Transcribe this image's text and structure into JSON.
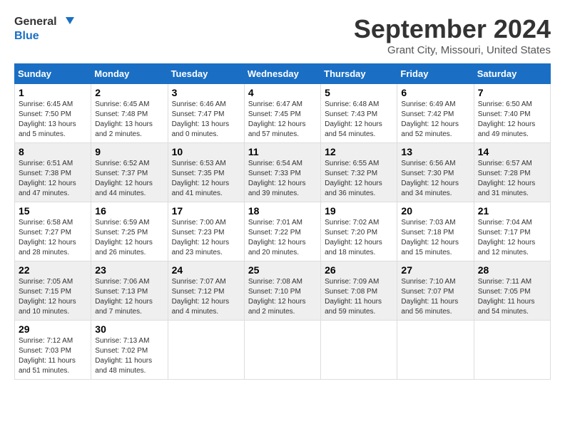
{
  "logo": {
    "line1": "General",
    "line2": "Blue"
  },
  "title": "September 2024",
  "subtitle": "Grant City, Missouri, United States",
  "headers": [
    "Sunday",
    "Monday",
    "Tuesday",
    "Wednesday",
    "Thursday",
    "Friday",
    "Saturday"
  ],
  "weeks": [
    [
      {
        "day": "1",
        "info": "Sunrise: 6:45 AM\nSunset: 7:50 PM\nDaylight: 13 hours and 5 minutes."
      },
      {
        "day": "2",
        "info": "Sunrise: 6:45 AM\nSunset: 7:48 PM\nDaylight: 13 hours and 2 minutes."
      },
      {
        "day": "3",
        "info": "Sunrise: 6:46 AM\nSunset: 7:47 PM\nDaylight: 13 hours and 0 minutes."
      },
      {
        "day": "4",
        "info": "Sunrise: 6:47 AM\nSunset: 7:45 PM\nDaylight: 12 hours and 57 minutes."
      },
      {
        "day": "5",
        "info": "Sunrise: 6:48 AM\nSunset: 7:43 PM\nDaylight: 12 hours and 54 minutes."
      },
      {
        "day": "6",
        "info": "Sunrise: 6:49 AM\nSunset: 7:42 PM\nDaylight: 12 hours and 52 minutes."
      },
      {
        "day": "7",
        "info": "Sunrise: 6:50 AM\nSunset: 7:40 PM\nDaylight: 12 hours and 49 minutes."
      }
    ],
    [
      {
        "day": "8",
        "info": "Sunrise: 6:51 AM\nSunset: 7:38 PM\nDaylight: 12 hours and 47 minutes."
      },
      {
        "day": "9",
        "info": "Sunrise: 6:52 AM\nSunset: 7:37 PM\nDaylight: 12 hours and 44 minutes."
      },
      {
        "day": "10",
        "info": "Sunrise: 6:53 AM\nSunset: 7:35 PM\nDaylight: 12 hours and 41 minutes."
      },
      {
        "day": "11",
        "info": "Sunrise: 6:54 AM\nSunset: 7:33 PM\nDaylight: 12 hours and 39 minutes."
      },
      {
        "day": "12",
        "info": "Sunrise: 6:55 AM\nSunset: 7:32 PM\nDaylight: 12 hours and 36 minutes."
      },
      {
        "day": "13",
        "info": "Sunrise: 6:56 AM\nSunset: 7:30 PM\nDaylight: 12 hours and 34 minutes."
      },
      {
        "day": "14",
        "info": "Sunrise: 6:57 AM\nSunset: 7:28 PM\nDaylight: 12 hours and 31 minutes."
      }
    ],
    [
      {
        "day": "15",
        "info": "Sunrise: 6:58 AM\nSunset: 7:27 PM\nDaylight: 12 hours and 28 minutes."
      },
      {
        "day": "16",
        "info": "Sunrise: 6:59 AM\nSunset: 7:25 PM\nDaylight: 12 hours and 26 minutes."
      },
      {
        "day": "17",
        "info": "Sunrise: 7:00 AM\nSunset: 7:23 PM\nDaylight: 12 hours and 23 minutes."
      },
      {
        "day": "18",
        "info": "Sunrise: 7:01 AM\nSunset: 7:22 PM\nDaylight: 12 hours and 20 minutes."
      },
      {
        "day": "19",
        "info": "Sunrise: 7:02 AM\nSunset: 7:20 PM\nDaylight: 12 hours and 18 minutes."
      },
      {
        "day": "20",
        "info": "Sunrise: 7:03 AM\nSunset: 7:18 PM\nDaylight: 12 hours and 15 minutes."
      },
      {
        "day": "21",
        "info": "Sunrise: 7:04 AM\nSunset: 7:17 PM\nDaylight: 12 hours and 12 minutes."
      }
    ],
    [
      {
        "day": "22",
        "info": "Sunrise: 7:05 AM\nSunset: 7:15 PM\nDaylight: 12 hours and 10 minutes."
      },
      {
        "day": "23",
        "info": "Sunrise: 7:06 AM\nSunset: 7:13 PM\nDaylight: 12 hours and 7 minutes."
      },
      {
        "day": "24",
        "info": "Sunrise: 7:07 AM\nSunset: 7:12 PM\nDaylight: 12 hours and 4 minutes."
      },
      {
        "day": "25",
        "info": "Sunrise: 7:08 AM\nSunset: 7:10 PM\nDaylight: 12 hours and 2 minutes."
      },
      {
        "day": "26",
        "info": "Sunrise: 7:09 AM\nSunset: 7:08 PM\nDaylight: 11 hours and 59 minutes."
      },
      {
        "day": "27",
        "info": "Sunrise: 7:10 AM\nSunset: 7:07 PM\nDaylight: 11 hours and 56 minutes."
      },
      {
        "day": "28",
        "info": "Sunrise: 7:11 AM\nSunset: 7:05 PM\nDaylight: 11 hours and 54 minutes."
      }
    ],
    [
      {
        "day": "29",
        "info": "Sunrise: 7:12 AM\nSunset: 7:03 PM\nDaylight: 11 hours and 51 minutes."
      },
      {
        "day": "30",
        "info": "Sunrise: 7:13 AM\nSunset: 7:02 PM\nDaylight: 11 hours and 48 minutes."
      },
      {
        "day": "",
        "info": ""
      },
      {
        "day": "",
        "info": ""
      },
      {
        "day": "",
        "info": ""
      },
      {
        "day": "",
        "info": ""
      },
      {
        "day": "",
        "info": ""
      }
    ]
  ]
}
